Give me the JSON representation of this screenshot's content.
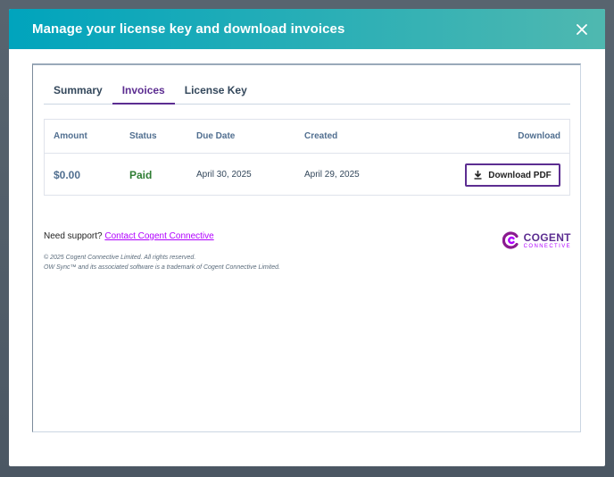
{
  "modal": {
    "title": "Manage your license key and download invoices"
  },
  "tabs": [
    {
      "label": "Summary",
      "active": false
    },
    {
      "label": "Invoices",
      "active": true
    },
    {
      "label": "License Key",
      "active": false
    }
  ],
  "table": {
    "headers": {
      "amount": "Amount",
      "status": "Status",
      "due_date": "Due Date",
      "created": "Created",
      "download": "Download"
    },
    "rows": [
      {
        "amount": "$0.00",
        "status": "Paid",
        "due_date": "April 30, 2025",
        "created": "April 29, 2025",
        "download_label": "Download PDF"
      }
    ]
  },
  "support": {
    "prefix": "Need support?",
    "link_text": "Contact Cogent Connective"
  },
  "legal": {
    "copyright": "© 2025 Cogent Connective Limited. All rights reserved.",
    "trademark": "OW Sync™ and its associated software is a trademark of Cogent Connective Limited."
  },
  "logo": {
    "main": "COGENT",
    "sub": "CONNECTIVE"
  },
  "colors": {
    "header_start": "#00a4bd",
    "header_end": "#4fb8b0",
    "accent": "#5c2d91",
    "link": "#b100ff",
    "paid": "#2e7d32"
  },
  "icons": {
    "close": "close-icon",
    "download": "download-icon",
    "logo": "cogent-logo-icon"
  }
}
